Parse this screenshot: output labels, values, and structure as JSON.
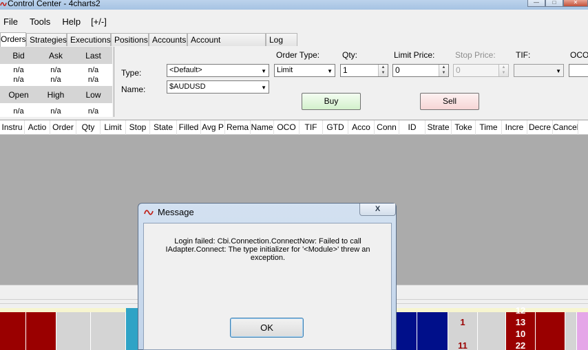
{
  "window": {
    "title": "Control Center - 4charts2"
  },
  "menu": [
    "File",
    "Tools",
    "Help",
    "[+/-]"
  ],
  "tabs": [
    "Orders",
    "Strategies",
    "Executions",
    "Positions",
    "Accounts",
    "Account Performance",
    "Log"
  ],
  "quote": {
    "top_headers": [
      "Bid",
      "Ask",
      "Last"
    ],
    "top_rows": [
      [
        "n/a",
        "n/a",
        "n/a"
      ],
      [
        "n/a",
        "n/a",
        "n/a"
      ]
    ],
    "bottom_headers": [
      "Open",
      "High",
      "Low"
    ],
    "bottom_rows": [
      [
        "n/a",
        "n/a",
        "n/a"
      ]
    ]
  },
  "order_entry": {
    "type_label": "Type:",
    "type_value": "<Default>",
    "name_label": "Name:",
    "name_value": "$AUDUSD",
    "order_type_label": "Order Type:",
    "order_type_value": "Limit",
    "qty_label": "Qty:",
    "qty_value": "1",
    "limit_price_label": "Limit Price:",
    "limit_price_value": "0",
    "stop_price_label": "Stop Price:",
    "stop_price_value": "0",
    "tif_label": "TIF:",
    "tif_value": "",
    "oco_label": "OCO",
    "buy_label": "Buy",
    "sell_label": "Sell"
  },
  "columns": [
    "Instru",
    "Actio",
    "Order",
    "Qty",
    "Limit",
    "Stop",
    "State",
    "Filled",
    "Avg P",
    "Rema",
    "Name",
    "OCO",
    "TIF",
    "GTD",
    "Acco",
    "Conn",
    "ID",
    "Strate",
    "Toke",
    "Time",
    "Incre",
    "Decre",
    "Cancel"
  ],
  "ladder": {
    "left_values": [
      "1",
      "11"
    ],
    "right_values": [
      "12",
      "13",
      "10",
      "22"
    ]
  },
  "colors": {
    "bid_blue": "#000f8a",
    "ask_red": "#9a0000",
    "accent": "#3c7fb1"
  },
  "dialog": {
    "title": "Message",
    "message": "Login failed: Cbi.Connection.ConnectNow: Failed to call IAdapter.Connect:  The type initializer for '<Module>' threw an exception.",
    "ok_label": "OK",
    "close_label": "X"
  }
}
